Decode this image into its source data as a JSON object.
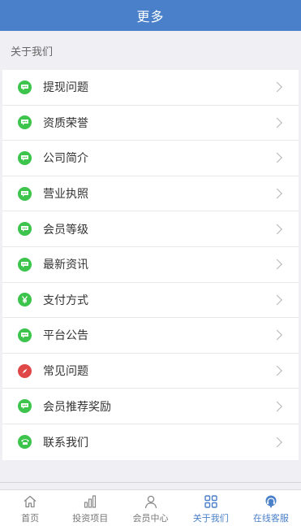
{
  "header": {
    "title": "更多"
  },
  "section": {
    "title": "关于我们"
  },
  "menu": {
    "items": [
      {
        "label": "提现问题",
        "icon": "chat-icon",
        "color": "#3cc44c"
      },
      {
        "label": "资质荣誉",
        "icon": "chat-icon",
        "color": "#3cc44c"
      },
      {
        "label": "公司简介",
        "icon": "chat-icon",
        "color": "#3cc44c"
      },
      {
        "label": "营业执照",
        "icon": "chat-icon",
        "color": "#3cc44c"
      },
      {
        "label": "会员等级",
        "icon": "chat-icon",
        "color": "#3cc44c"
      },
      {
        "label": "最新资讯",
        "icon": "chat-icon",
        "color": "#3cc44c"
      },
      {
        "label": "支付方式",
        "icon": "yen-icon",
        "color": "#3cc44c"
      },
      {
        "label": "平台公告",
        "icon": "chat-icon",
        "color": "#3cc44c"
      },
      {
        "label": "常见问题",
        "icon": "compass-icon",
        "color": "#e04848"
      },
      {
        "label": "会员推荐奖励",
        "icon": "chat-icon",
        "color": "#3cc44c"
      },
      {
        "label": "联系我们",
        "icon": "phone-icon",
        "color": "#3cc44c"
      }
    ]
  },
  "tabbar": {
    "tabs": [
      {
        "label": "首页",
        "icon": "home-icon"
      },
      {
        "label": "投资项目",
        "icon": "bar-chart-icon"
      },
      {
        "label": "会员中心",
        "icon": "user-icon"
      },
      {
        "label": "关于我们",
        "icon": "grid-icon",
        "active": true
      },
      {
        "label": "在线客服",
        "icon": "headset-icon",
        "active": true
      }
    ],
    "active_color": "#4a80c9"
  }
}
